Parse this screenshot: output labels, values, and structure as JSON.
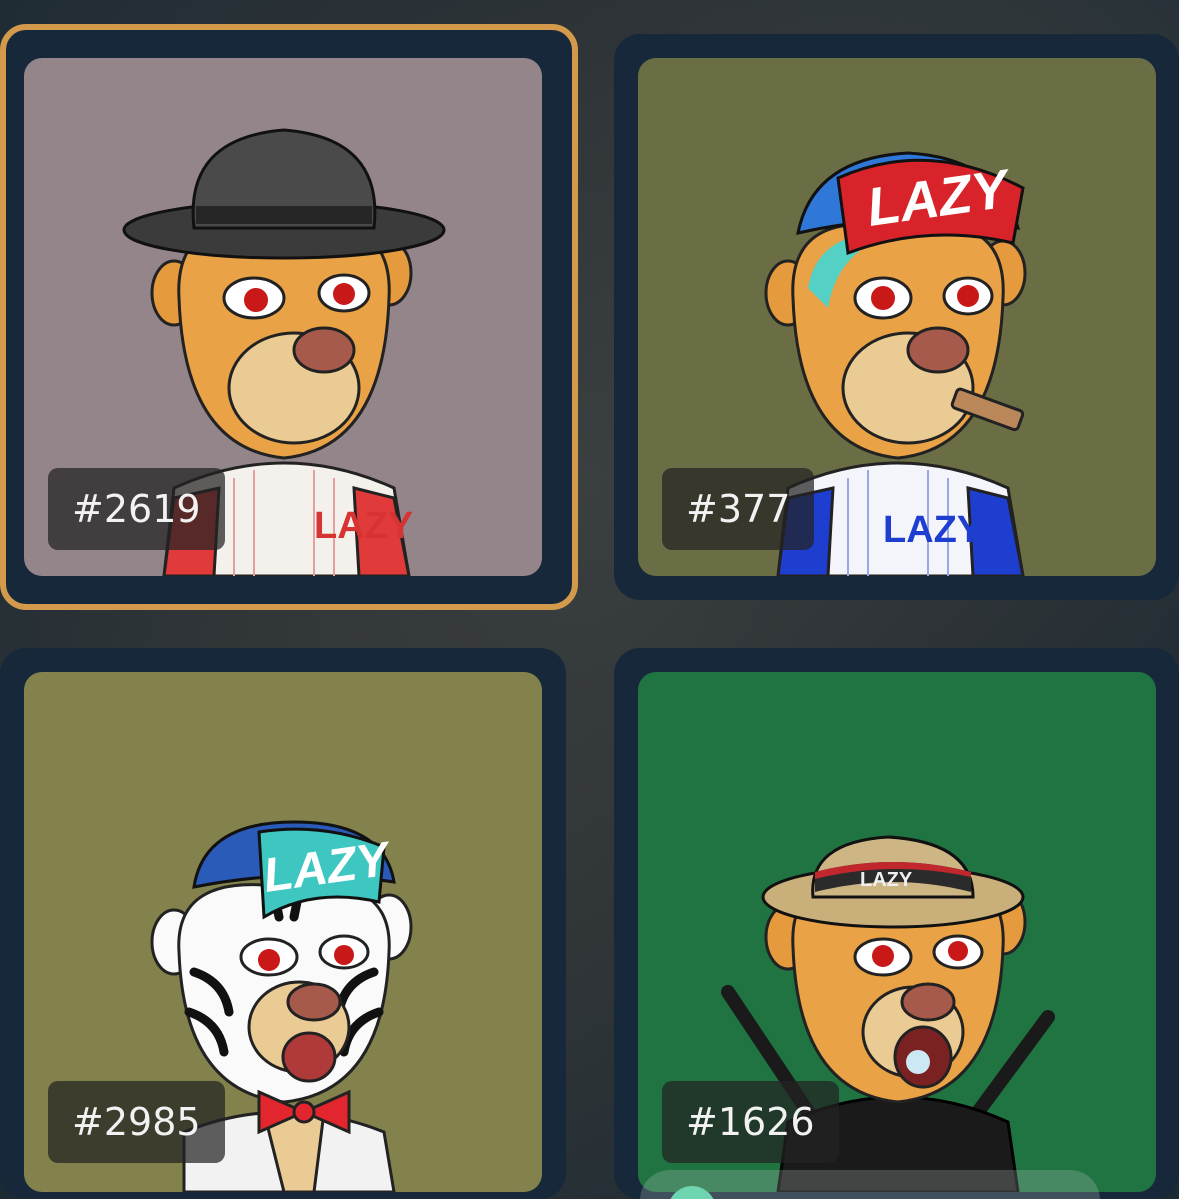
{
  "grid": {
    "items": [
      {
        "label": "#2619",
        "selected": true,
        "background_color": "#938589",
        "hat": "campaign-hat",
        "hat_color": "#3a3a3a",
        "hat_text": "",
        "jersey_text": "LAZY",
        "jersey_accent": "#e03a3a",
        "species": "lion"
      },
      {
        "label": "#377",
        "selected": false,
        "background_color": "#6b6e45",
        "hat": "baseball-cap",
        "hat_color": "#d8232a",
        "hat_text": "LAZY",
        "jersey_text": "LAZY",
        "jersey_accent": "#1e3ed0",
        "species": "lion"
      },
      {
        "label": "#2985",
        "selected": false,
        "background_color": "#83824c",
        "hat": "baseball-cap",
        "hat_color": "#3ec7c0",
        "hat_text": "LAZY",
        "jersey_text": "",
        "jersey_accent": "#e3262d",
        "species": "zebra-lion"
      },
      {
        "label": "#1626",
        "selected": false,
        "background_color": "#1f7441",
        "hat": "bucket-hat",
        "hat_color": "#c9b07a",
        "hat_text": "LAZY",
        "jersey_text": "",
        "jersey_accent": "#1a1a1a",
        "species": "lion"
      }
    ]
  }
}
